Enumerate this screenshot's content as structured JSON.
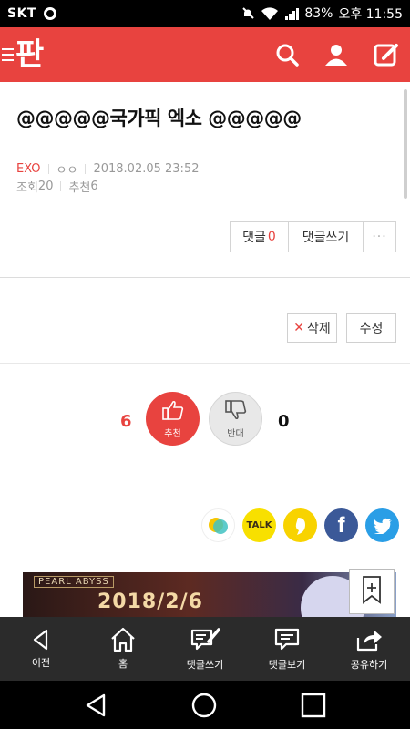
{
  "status_bar": {
    "carrier": "SKT",
    "battery": "83%",
    "clock": "오후 11:55"
  },
  "app_bar": {
    "logo": "판",
    "icons": [
      "search-icon",
      "user-icon",
      "write-icon"
    ]
  },
  "post": {
    "title": "@@@@@국가픽 엑소 @@@@@",
    "category": "EXO",
    "author": "ㅇㅇ",
    "datetime": "2018.02.05 23:52",
    "views_label": "조회",
    "views": "20",
    "recommends_label": "추천",
    "recommends": "6"
  },
  "comment_buttons": {
    "comments_label": "댓글",
    "comments_count": "0",
    "write_label": "댓글쓰기",
    "more_label": "···"
  },
  "edit_buttons": {
    "delete_x": "✕",
    "delete_label": "삭제",
    "edit_label": "수정"
  },
  "vote": {
    "up_count": "6",
    "up_label": "추천",
    "down_label": "반대",
    "down_count": "0"
  },
  "share": {
    "items": [
      "kakaostory-icon",
      "kakaotalk-icon",
      "band-icon",
      "facebook-icon",
      "twitter-icon"
    ],
    "talk_text": "TALK",
    "fb_text": "f"
  },
  "ad": {
    "brand": "PEARL ABYSS",
    "date": "2018/2/6"
  },
  "bottom_nav": {
    "items": [
      {
        "label": "이전",
        "icon": "back-icon"
      },
      {
        "label": "홈",
        "icon": "home-icon"
      },
      {
        "label": "댓글쓰기",
        "icon": "comment-write-icon"
      },
      {
        "label": "댓글보기",
        "icon": "comment-view-icon"
      },
      {
        "label": "공유하기",
        "icon": "share-icon"
      }
    ]
  },
  "colors": {
    "brand": "#e8433f",
    "nav_bg": "#2b2b2b"
  }
}
